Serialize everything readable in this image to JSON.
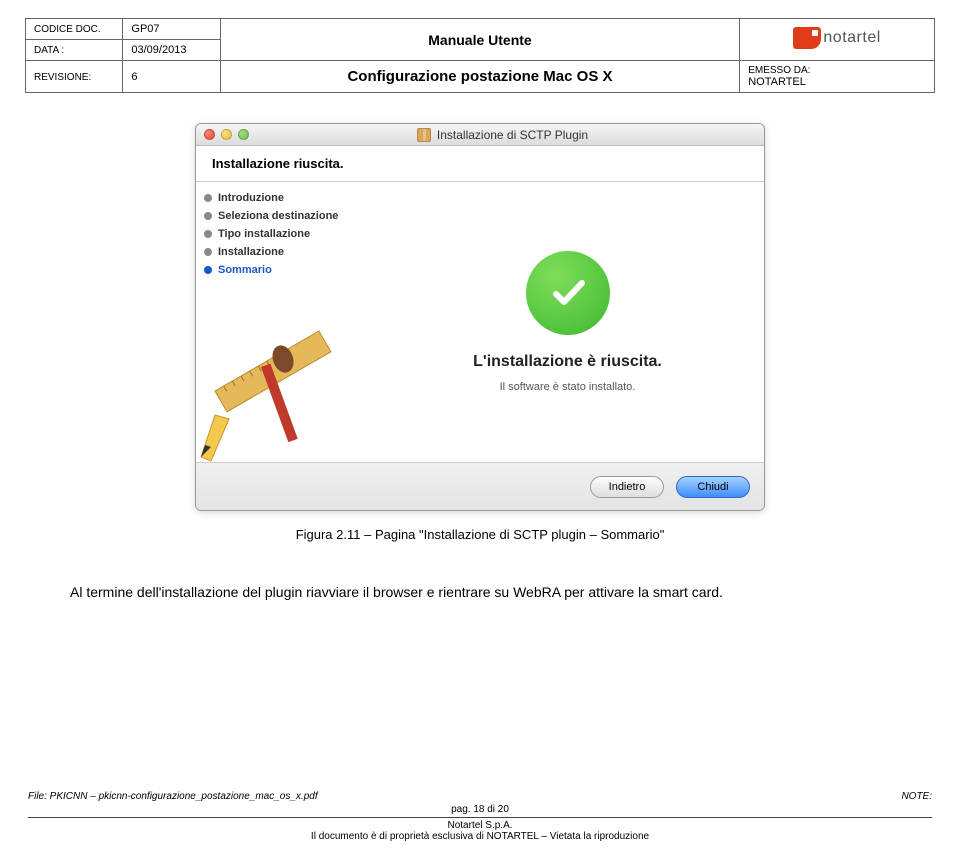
{
  "header": {
    "codice_label": "CODICE DOC.",
    "codice_value": "GP07",
    "data_label": "DATA :",
    "data_value": "03/09/2013",
    "revisione_label": "REVISIONE:",
    "revisione_value": "6",
    "manual_title": "Manuale Utente",
    "subtitle": "Configurazione postazione Mac OS X",
    "emesso_label": "EMESSO DA:",
    "emesso_value": "NOTARTEL",
    "logo_text": "notartel"
  },
  "installer": {
    "window_title": "Installazione di SCTP Plugin",
    "heading": "Installazione riuscita.",
    "steps": {
      "0": {
        "label": "Introduzione"
      },
      "1": {
        "label": "Seleziona destinazione"
      },
      "2": {
        "label": "Tipo installazione"
      },
      "3": {
        "label": "Installazione"
      },
      "4": {
        "label": "Sommario"
      }
    },
    "success_title": "L'installazione è riuscita.",
    "success_sub": "Il software è stato installato.",
    "back_btn": "Indietro",
    "close_btn": "Chiudi"
  },
  "caption": "Figura 2.11 – Pagina \"Installazione di SCTP plugin – Sommario\"",
  "body_text": "Al termine dell'installazione del plugin riavviare il browser e rientrare su WebRA per attivare la smart card.",
  "footer": {
    "file_label": "File: PKICNN – pkicnn-configurazione_postazione_mac_os_x.pdf",
    "note_label": "NOTE:",
    "page": "pag. 18 di 20",
    "company": "Notartel S.p.A.",
    "disclaimer": "Il documento è di proprietà esclusiva di NOTARTEL – Vietata la riproduzione"
  }
}
